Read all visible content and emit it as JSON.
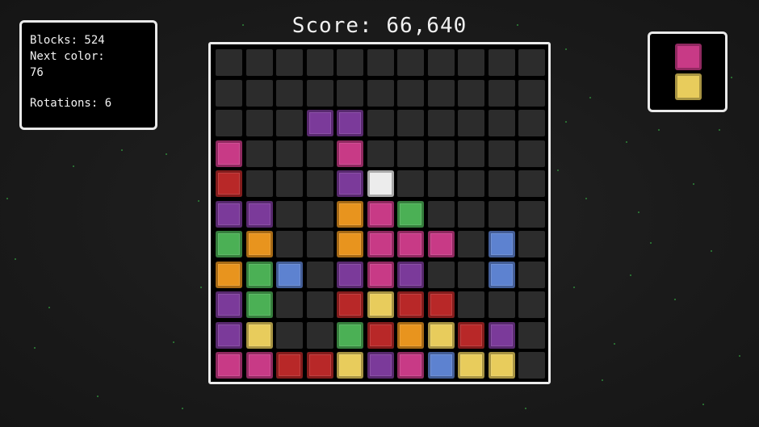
{
  "stats": {
    "blocks": "Blocks: 524",
    "next_color_label": "Next color:",
    "next_color_value": "76",
    "rotations": "Rotations: 6"
  },
  "score": {
    "label": "Score:",
    "value": "66,640"
  },
  "colors": {
    "P": "#7b3a9a",
    "M": "#c83a86",
    "R": "#b82828",
    "W": "#ececec",
    "O": "#e8941e",
    "G": "#4bb055",
    "B": "#5d82d0",
    "Y": "#e8cc5c",
    "empty": "#2c2c2c",
    "board_border": "#ececec",
    "panel_border": "#e9e9e9"
  },
  "board": {
    "cols": 11,
    "rows": 11,
    "cells": [
      "...........",
      "...........",
      "...PP......",
      "M...M......",
      "R...PW.....",
      "PP..OMG....",
      "GO..OMMM.B.",
      "OGB.PMP..B.",
      "PG..RYRR...",
      "PY..GROYRP.",
      "MMRRYPMBYY."
    ]
  },
  "next_piece": [
    "M",
    "Y"
  ]
}
